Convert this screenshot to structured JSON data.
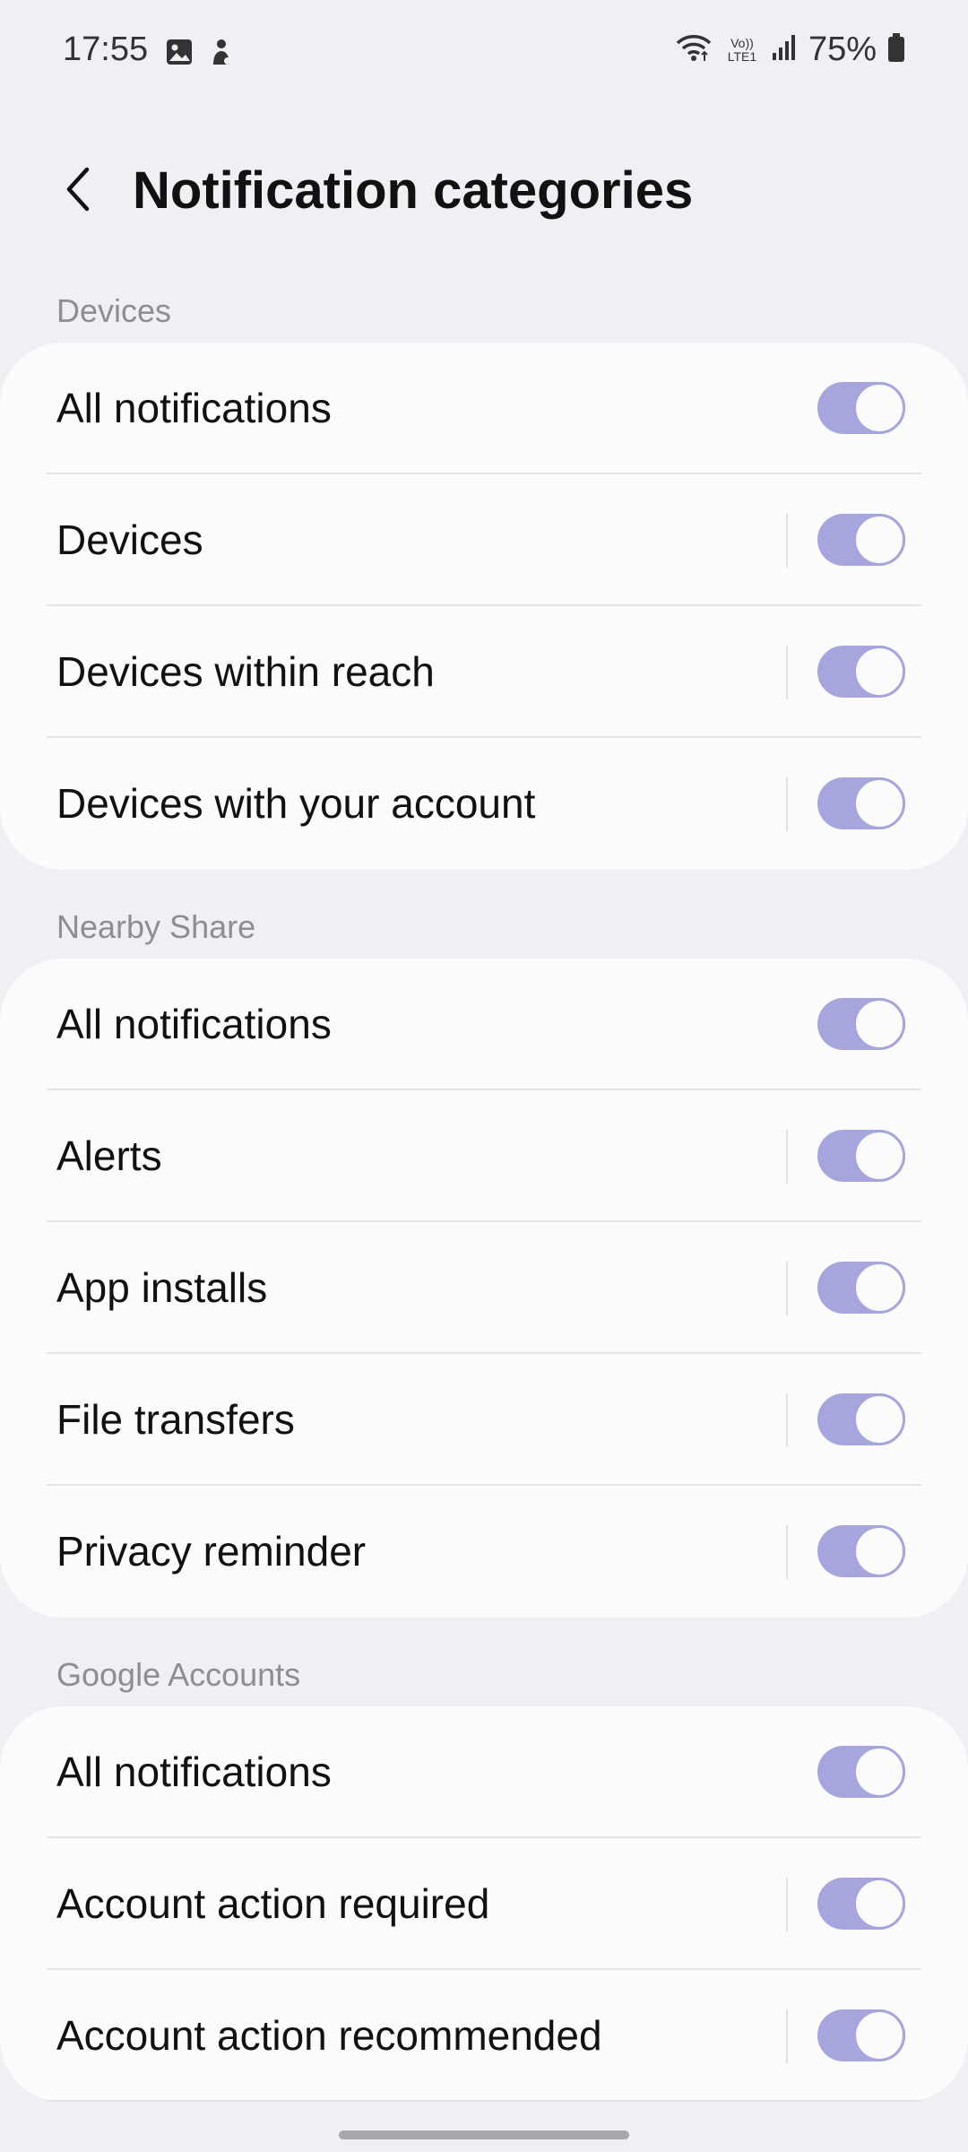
{
  "status_bar": {
    "time": "17:55",
    "battery": "75%",
    "network_label": "Vo)) LTE1",
    "icons": [
      "gallery-icon",
      "notification-icon",
      "wifi-icon",
      "volte-icon",
      "signal-icon",
      "battery-icon"
    ]
  },
  "header": {
    "title": "Notification categories",
    "back_icon": "chevron-left-icon"
  },
  "sections": [
    {
      "label": "Devices",
      "items": [
        {
          "label": "All notifications",
          "enabled": true
        },
        {
          "label": "Devices",
          "enabled": true
        },
        {
          "label": "Devices within reach",
          "enabled": true
        },
        {
          "label": "Devices with your account",
          "enabled": true
        }
      ]
    },
    {
      "label": "Nearby Share",
      "items": [
        {
          "label": "All notifications",
          "enabled": true
        },
        {
          "label": "Alerts",
          "enabled": true
        },
        {
          "label": "App installs",
          "enabled": true
        },
        {
          "label": "File transfers",
          "enabled": true
        },
        {
          "label": "Privacy reminder",
          "enabled": true
        }
      ]
    },
    {
      "label": "Google Accounts",
      "items": [
        {
          "label": "All notifications",
          "enabled": true
        },
        {
          "label": "Account action required",
          "enabled": true
        },
        {
          "label": "Account action recommended",
          "enabled": true
        }
      ]
    }
  ],
  "colors": {
    "background": "#f0eff4",
    "card": "#fbfbfb",
    "toggle_on": "#a7a5dd",
    "section_label": "#8d8d93"
  }
}
